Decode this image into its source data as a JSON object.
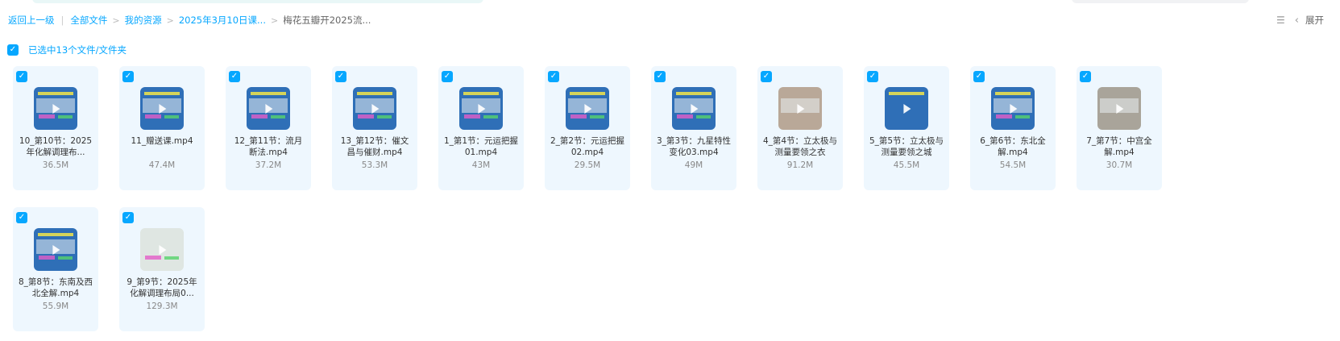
{
  "breadcrumb": {
    "back": "返回上一级",
    "items": [
      "全部文件",
      "我的资源",
      "2025年3月10日课...",
      "梅花五瓣开2025流..."
    ]
  },
  "toolbar": {
    "expand_label": "展开"
  },
  "selection": {
    "label": "已选中13个文件/文件夹"
  },
  "files": [
    {
      "name": "10_第10节：2025年化解调理布...",
      "size": "36.5M"
    },
    {
      "name": "11_赠送课.mp4",
      "size": "47.4M"
    },
    {
      "name": "12_第11节：流月断法.mp4",
      "size": "37.2M"
    },
    {
      "name": "13_第12节：催文昌与催财.mp4",
      "size": "53.3M"
    },
    {
      "name": "1_第1节：元运把握01.mp4",
      "size": "43M"
    },
    {
      "name": "2_第2节：元运把握02.mp4",
      "size": "29.5M"
    },
    {
      "name": "3_第3节：九星特性变化03.mp4",
      "size": "49M"
    },
    {
      "name": "4_第4节：立太极与测量要领之衣",
      "size": "91.2M"
    },
    {
      "name": "5_第5节：立太极与测量要领之城",
      "size": "45.5M"
    },
    {
      "name": "6_第6节：东北全解.mp4",
      "size": "54.5M"
    },
    {
      "name": "7_第7节：中宫全解.mp4",
      "size": "30.7M"
    },
    {
      "name": "8_第8节：东南及西北全解.mp4",
      "size": "55.9M"
    },
    {
      "name": "9_第9节：2025年化解调理布局0...",
      "size": "129.3M"
    }
  ]
}
